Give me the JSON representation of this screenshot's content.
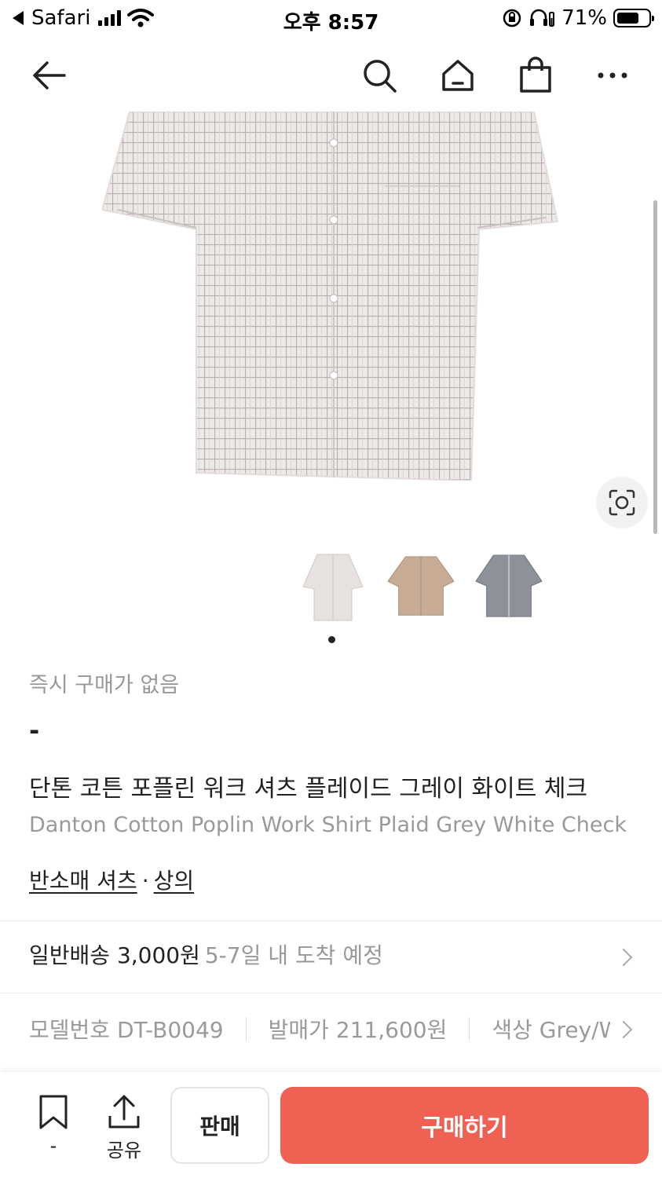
{
  "status_bar": {
    "back_app": "Safari",
    "time": "오후 8:57",
    "battery_percent": "71%",
    "battery_level": 0.71
  },
  "nav": {
    "icons": [
      "back-arrow-icon",
      "search-icon",
      "home-icon",
      "shopping-bag-icon",
      "more-icon"
    ]
  },
  "product": {
    "thumbnails": [
      "grey-white-check-shirt",
      "beige-shirt",
      "grey-stripe-shirt"
    ],
    "selected_thumbnail": 1,
    "price_label": "즉시 구매가 없음",
    "price_value": "-",
    "title_ko": "단톤 코튼 포플린 워크 셔츠 플레이드 그레이 화이트 체크",
    "title_en": "Danton Cotton Poplin Work Shirt Plaid Grey White Check",
    "categories": [
      "반소매 셔츠",
      "상의"
    ],
    "category_separator": "·"
  },
  "shipping": {
    "method": "일반배송 3,000원",
    "eta": "5-7일 내 도착 예정"
  },
  "specs": {
    "model": "모델번호 DT-B0049",
    "release_price": "발매가 211,600원",
    "color": "색상 Grey/White"
  },
  "bottom_bar": {
    "bookmark_count": "-",
    "share_label": "공유",
    "sell_label": "판매",
    "buy_label": "구매하기"
  },
  "colors": {
    "accent": "#ef6253",
    "muted_text": "#999999"
  }
}
